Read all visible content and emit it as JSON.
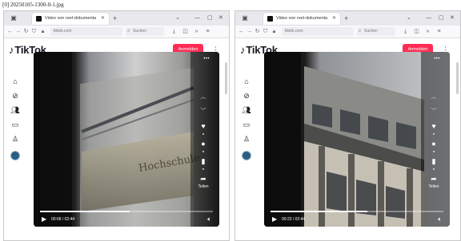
{
  "caption": "[0] 20250105-1300-0-1.jpg",
  "windows": [
    {
      "tab_title": "Video von reel-dokumenta...",
      "url": "tiktok.com",
      "search_placeholder": "Suchen",
      "logo": "TikTok",
      "login_label": "Anmelden",
      "video": {
        "time": "00:06 / 02:44",
        "progress": 0.52,
        "share_label": "Teilen"
      }
    },
    {
      "tab_title": "Video von reel-dokumenta...",
      "url": "tiktok.com",
      "search_placeholder": "Suchen",
      "logo": "TikTok",
      "login_label": "Anmelden",
      "video": {
        "time": "00:22 / 02:44",
        "progress": 0.56,
        "share_label": "Teilen"
      }
    }
  ],
  "icons": {
    "home": "home-icon",
    "explore": "compass-icon",
    "following": "people-icon",
    "live": "live-icon",
    "profile": "profile-icon",
    "like": "heart-icon",
    "comment": "comment-icon",
    "save": "bookmark-icon",
    "share": "share-icon"
  },
  "colors": {
    "brand": "#fe2c55",
    "video_bg": "#121212"
  }
}
